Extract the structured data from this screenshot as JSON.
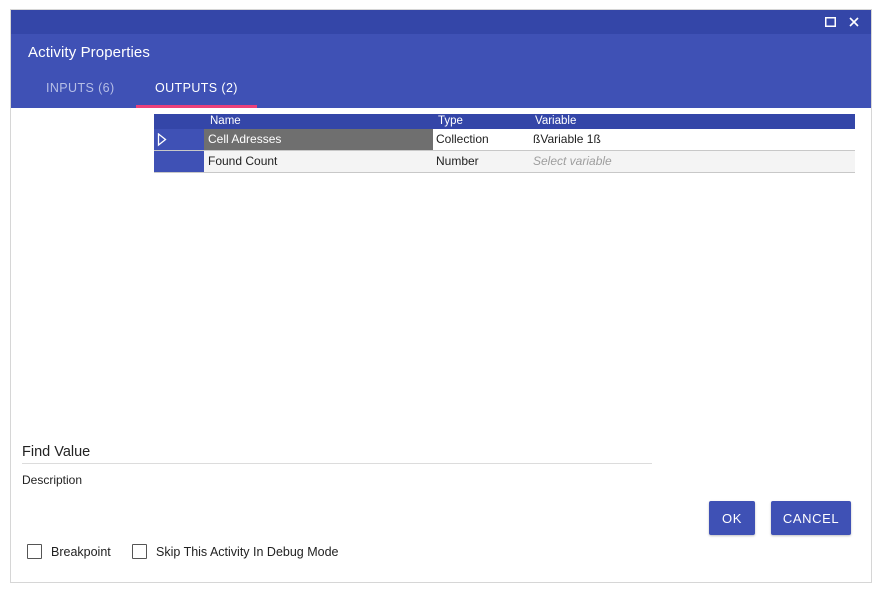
{
  "window": {
    "title": "Activity Properties",
    "maximize_icon": "maximize-icon",
    "close_icon": "close-icon"
  },
  "tabs": [
    {
      "label": "INPUTS (6)",
      "active": false
    },
    {
      "label": "OUTPUTS (2)",
      "active": true
    }
  ],
  "grid": {
    "columns": [
      "Name",
      "Type",
      "Variable"
    ],
    "rows": [
      {
        "name": "Cell Adresses",
        "type": "Collection",
        "variable": "ßVariable 1ß",
        "selected": true
      },
      {
        "name": "Found Count",
        "type": "Number",
        "variable": "",
        "placeholder": "Select variable",
        "selected": false
      }
    ]
  },
  "activity": {
    "name": "Find Value",
    "description_label": "Description"
  },
  "buttons": {
    "ok": "OK",
    "cancel": "CANCEL"
  },
  "options": {
    "breakpoint": {
      "label": "Breakpoint",
      "checked": false
    },
    "skip_debug": {
      "label": "Skip This Activity In Debug Mode",
      "checked": false
    }
  },
  "colors": {
    "header": "#3f51b5",
    "titlebar": "#3446a8",
    "tab_indicator": "#ec407a",
    "selected_cell": "#6f6f6f"
  }
}
